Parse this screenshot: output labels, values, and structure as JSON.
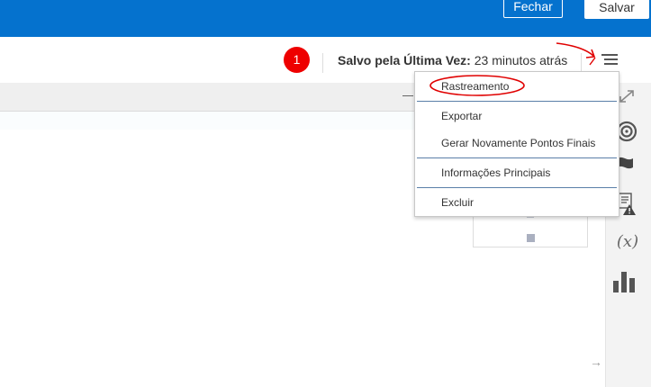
{
  "header": {
    "close_label": "Fechar",
    "save_label": "Salvar"
  },
  "toolbar": {
    "messages_count": "1",
    "last_saved_label": "Salvo pela Última Vez:",
    "last_saved_value": "23 minutos atrás",
    "menu_icon": "hamburger-menu-icon"
  },
  "menu": {
    "items": [
      {
        "label": "Rastreamento"
      },
      {
        "label": "Exportar"
      },
      {
        "label": "Gerar Novamente Pontos Finais"
      },
      {
        "label": "Informações Principais"
      },
      {
        "label": "Excluir"
      }
    ]
  },
  "right_panel": {
    "icons": [
      "expand-icon",
      "target-icon",
      "flag-icon",
      "warning-list-icon",
      "variable-icon",
      "bar-chart-icon"
    ],
    "variable_glyph": "(x)"
  },
  "colors": {
    "header_bg": "#0572ce",
    "badge_bg": "#ee0000",
    "annotation": "#e00000"
  }
}
